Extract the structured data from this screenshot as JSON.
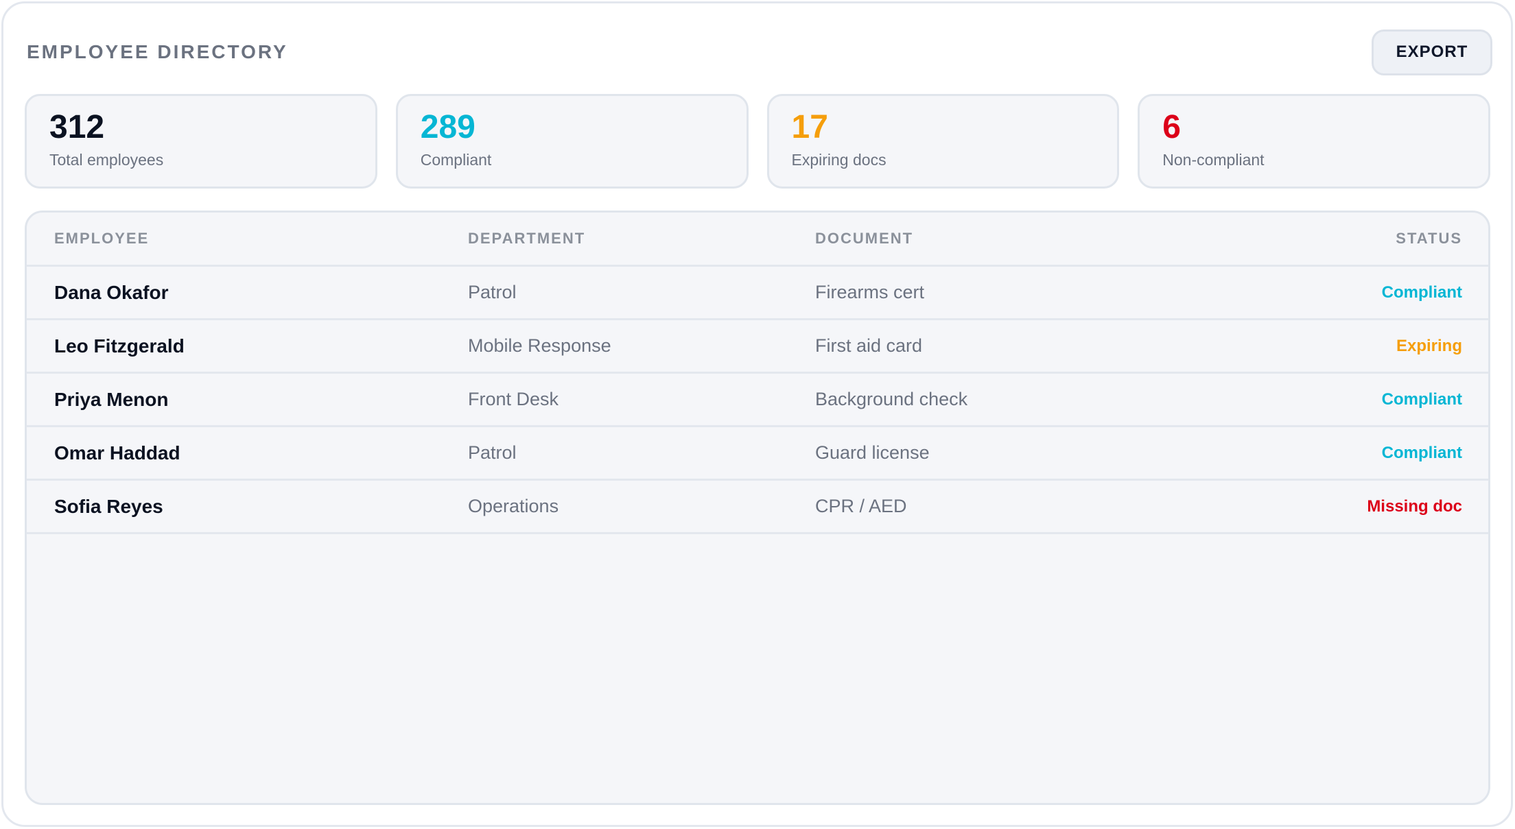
{
  "header": {
    "title": "EMPLOYEE DIRECTORY",
    "export_label": "EXPORT"
  },
  "stats": [
    {
      "value": "312",
      "label": "Total employees",
      "color": "#0b1221"
    },
    {
      "value": "289",
      "label": "Compliant",
      "color": "#06b6d4"
    },
    {
      "value": "17",
      "label": "Expiring docs",
      "color": "#f59e0b"
    },
    {
      "value": "6",
      "label": "Non-compliant",
      "color": "#dc0019"
    }
  ],
  "table": {
    "columns": [
      "EMPLOYEE",
      "DEPARTMENT",
      "DOCUMENT",
      "STATUS"
    ],
    "rows": [
      {
        "employee": "Dana Okafor",
        "department": "Patrol",
        "document": "Firearms cert",
        "status": "Compliant",
        "status_color": "#06b6d4"
      },
      {
        "employee": "Leo Fitzgerald",
        "department": "Mobile Response",
        "document": "First aid card",
        "status": "Expiring",
        "status_color": "#f59e0b"
      },
      {
        "employee": "Priya Menon",
        "department": "Front Desk",
        "document": "Background check",
        "status": "Compliant",
        "status_color": "#06b6d4"
      },
      {
        "employee": "Omar Haddad",
        "department": "Patrol",
        "document": "Guard license",
        "status": "Compliant",
        "status_color": "#06b6d4"
      },
      {
        "employee": "Sofia Reyes",
        "department": "Operations",
        "document": "CPR / AED",
        "status": "Missing doc",
        "status_color": "#dc0019"
      }
    ]
  }
}
